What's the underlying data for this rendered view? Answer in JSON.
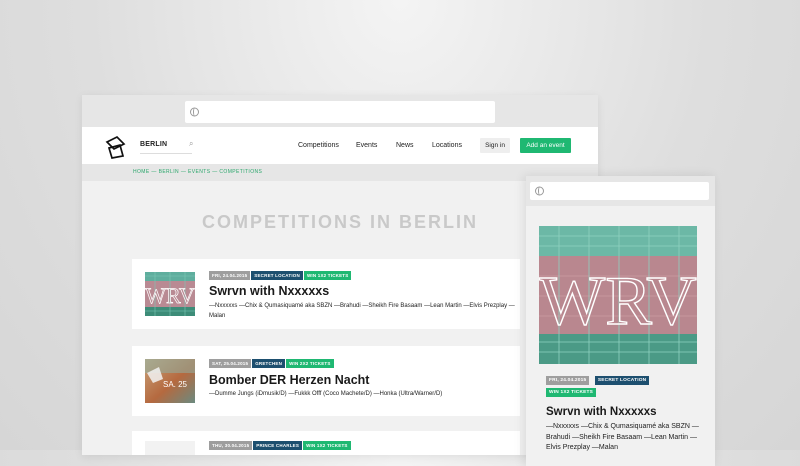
{
  "header": {
    "city": "BERLIN",
    "nav": [
      "Competitions",
      "Events",
      "News",
      "Locations"
    ],
    "sign_in": "Sign in",
    "add_event": "Add an event"
  },
  "breadcrumb": "HOME — BERLIN — EVENTS — COMPETITIONS",
  "page_title": "COMPETITIONS IN BERLIN",
  "cards": [
    {
      "tags": [
        "FRI, 24.04.2015",
        "SECRET LOCATION",
        "WIN 1X2 TICKETS"
      ],
      "title": "Swrvn with Nxxxxxs",
      "lineup": "—Nxxxxxs —Chix & Qumasiquamé aka SBZN —Brahudi —Sheikh Fire Basaam —Lean Martin —Elvis Prezplay —Malan",
      "thumb_text": "WRV"
    },
    {
      "tags": [
        "SAT, 25.04.2015",
        "GRETCHEN",
        "WIN 2X2 TICKETS"
      ],
      "title": "Bomber DER Herzen Nacht",
      "lineup": "—Dumme Jungs (iDmusik/D) —Fukkk Offf (Coco Machete/D) —Honka (Ultra/Warner/D)",
      "thumb_text": "SA. 25"
    },
    {
      "tags": [
        "THU, 30.04.2015",
        "PRINCE CHARLES",
        "WIN 1X2 TICKETS"
      ]
    }
  ],
  "mobile": {
    "tags": [
      "FRI, 24.04.2015",
      "SECRET LOCATION",
      "WIN 1X2 TICKETS"
    ],
    "title": "Swrvn with Nxxxxxs",
    "lineup": "—Nxxxxxs —Chix & Qumasiquamé aka SBZN —Brahudi —Sheikh Fire Basaam —Lean Martin —Elvis Prezplay —Malan",
    "image_text": "WRV"
  },
  "colors": {
    "accent_green": "#1fb872",
    "location_blue": "#1d4f6f",
    "date_grey": "#9e9e9e",
    "title_grey": "#c9c9c9"
  }
}
